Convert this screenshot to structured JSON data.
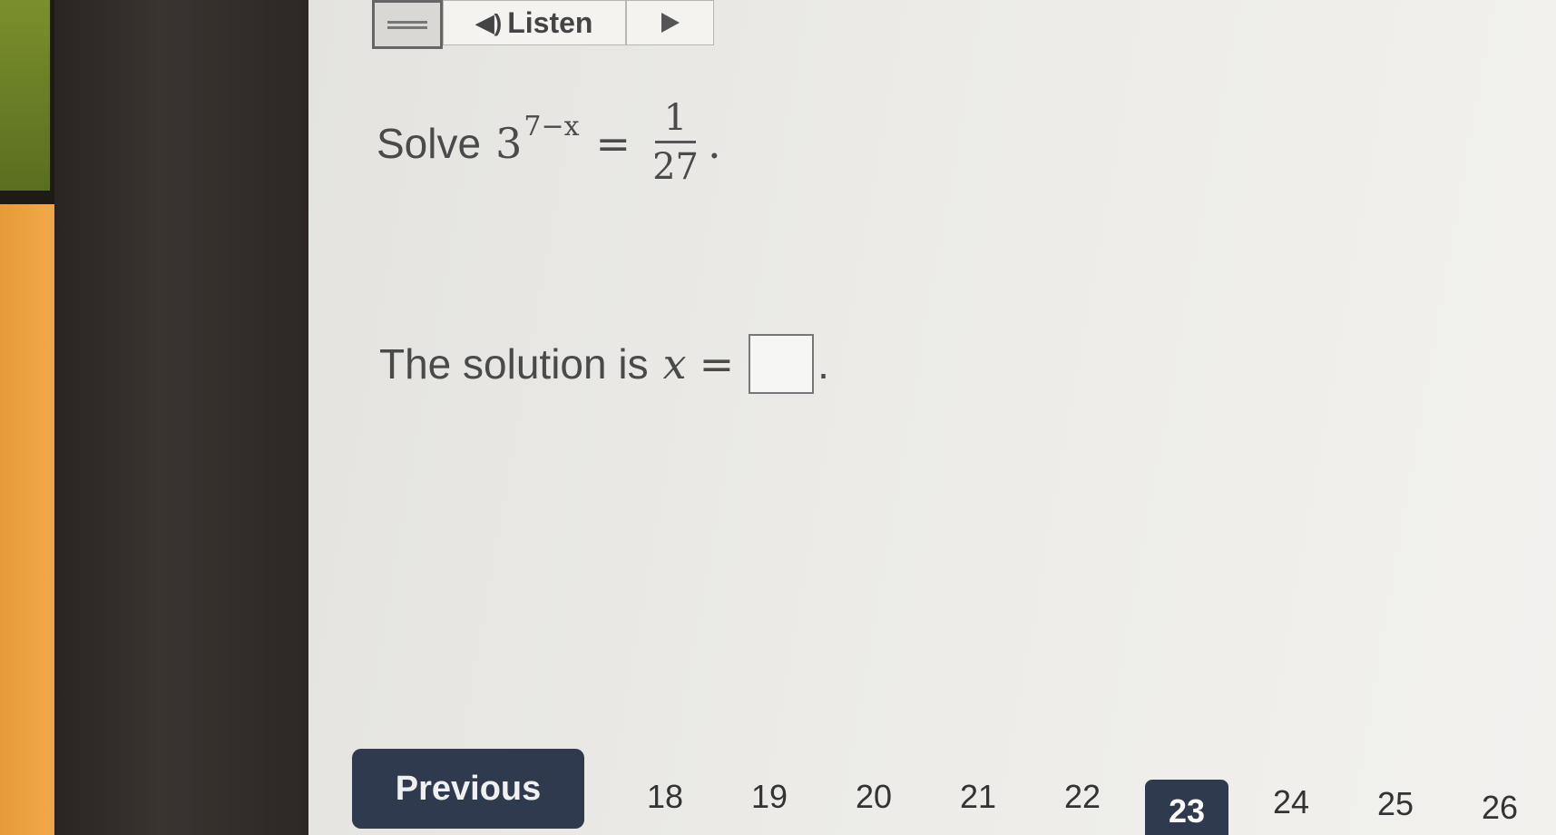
{
  "toolbar": {
    "menu_icon": "menu-icon",
    "listen_label": "Listen",
    "speaker_icon": "speaker-icon",
    "play_icon": "play-icon"
  },
  "question": {
    "prefix": "Solve",
    "base": "3",
    "exponent": "7−x",
    "equals": "=",
    "numerator": "1",
    "denominator": "27",
    "suffix": "."
  },
  "solution": {
    "text": "The solution is",
    "variable": "x",
    "equals": "=",
    "answer_value": "",
    "suffix": "."
  },
  "pager": {
    "previous_label": "Previous",
    "pages": [
      "18",
      "19",
      "20",
      "21",
      "22",
      "23",
      "24",
      "25",
      "26"
    ],
    "current_page": "23"
  },
  "colors": {
    "nav_button": "#2f3a4e",
    "page_background": "#ecebe7"
  }
}
